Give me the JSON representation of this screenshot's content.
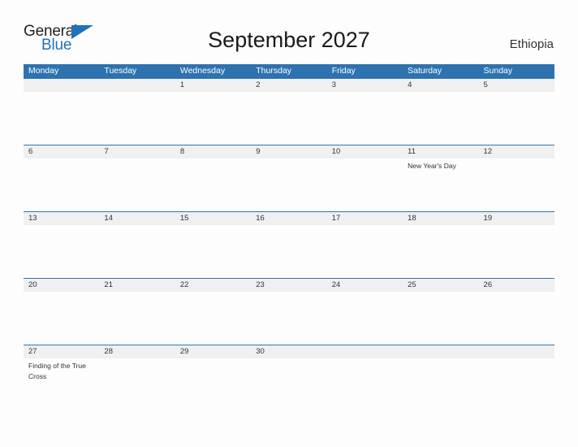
{
  "brand": {
    "name_part1": "General",
    "name_part2": "Blue",
    "flag_icon": "flag-triangle-icon",
    "accent_color": "#2272b8"
  },
  "header": {
    "title": "September 2027",
    "country": "Ethiopia"
  },
  "theme": {
    "header_blue": "#2e73b0",
    "row_gray": "#f0f0f0",
    "page_background": "#fdfdfd",
    "text_color": "#333333"
  },
  "calendar": {
    "month": "September",
    "year": "2027",
    "weekday_headers": [
      "Monday",
      "Tuesday",
      "Wednesday",
      "Thursday",
      "Friday",
      "Saturday",
      "Sunday"
    ],
    "weeks": [
      {
        "days": [
          {
            "date": "",
            "events": []
          },
          {
            "date": "",
            "events": []
          },
          {
            "date": "1",
            "events": []
          },
          {
            "date": "2",
            "events": []
          },
          {
            "date": "3",
            "events": []
          },
          {
            "date": "4",
            "events": []
          },
          {
            "date": "5",
            "events": []
          }
        ]
      },
      {
        "days": [
          {
            "date": "6",
            "events": []
          },
          {
            "date": "7",
            "events": []
          },
          {
            "date": "8",
            "events": []
          },
          {
            "date": "9",
            "events": []
          },
          {
            "date": "10",
            "events": []
          },
          {
            "date": "11",
            "events": [
              "New Year's Day"
            ]
          },
          {
            "date": "12",
            "events": []
          }
        ]
      },
      {
        "days": [
          {
            "date": "13",
            "events": []
          },
          {
            "date": "14",
            "events": []
          },
          {
            "date": "15",
            "events": []
          },
          {
            "date": "16",
            "events": []
          },
          {
            "date": "17",
            "events": []
          },
          {
            "date": "18",
            "events": []
          },
          {
            "date": "19",
            "events": []
          }
        ]
      },
      {
        "days": [
          {
            "date": "20",
            "events": []
          },
          {
            "date": "21",
            "events": []
          },
          {
            "date": "22",
            "events": []
          },
          {
            "date": "23",
            "events": []
          },
          {
            "date": "24",
            "events": []
          },
          {
            "date": "25",
            "events": []
          },
          {
            "date": "26",
            "events": []
          }
        ]
      },
      {
        "days": [
          {
            "date": "27",
            "events": [
              "Finding of the True Cross"
            ]
          },
          {
            "date": "28",
            "events": []
          },
          {
            "date": "29",
            "events": []
          },
          {
            "date": "30",
            "events": []
          },
          {
            "date": "",
            "events": []
          },
          {
            "date": "",
            "events": []
          },
          {
            "date": "",
            "events": []
          }
        ]
      }
    ]
  }
}
